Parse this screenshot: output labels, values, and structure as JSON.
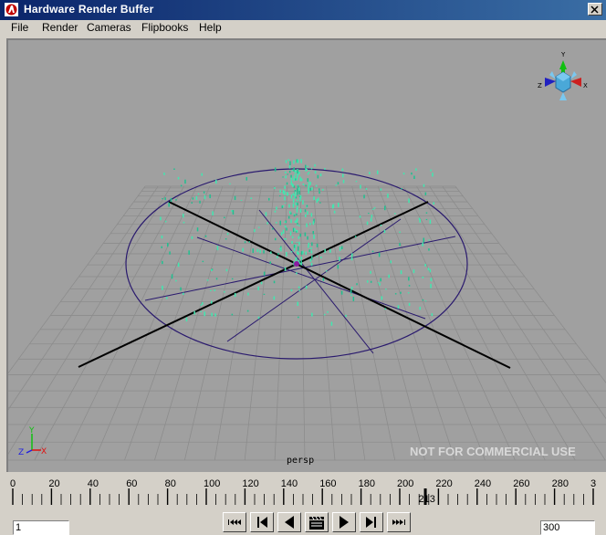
{
  "window": {
    "title": "Hardware Render Buffer"
  },
  "menu": [
    "File",
    "Render",
    "Cameras",
    "Flipbooks",
    "Help"
  ],
  "viewport": {
    "camera_label": "persp",
    "watermark": "NOT FOR COMMERCIAL USE"
  },
  "timeline": {
    "ticks": [
      "0",
      "20",
      "40",
      "60",
      "80",
      "100",
      "120",
      "140",
      "160",
      "180",
      "200",
      "220",
      "240",
      "260",
      "280",
      "3"
    ],
    "current_frame": "213"
  },
  "playback": {
    "start_value": "1",
    "end_value": "300",
    "buttons": [
      "go-to-start",
      "step-back-key",
      "play-backward",
      "render-sequence",
      "play-forward",
      "step-forward-key",
      "go-to-end"
    ]
  },
  "axis_colors": {
    "x": "#e01010",
    "y": "#10c010",
    "z": "#2020e0"
  }
}
